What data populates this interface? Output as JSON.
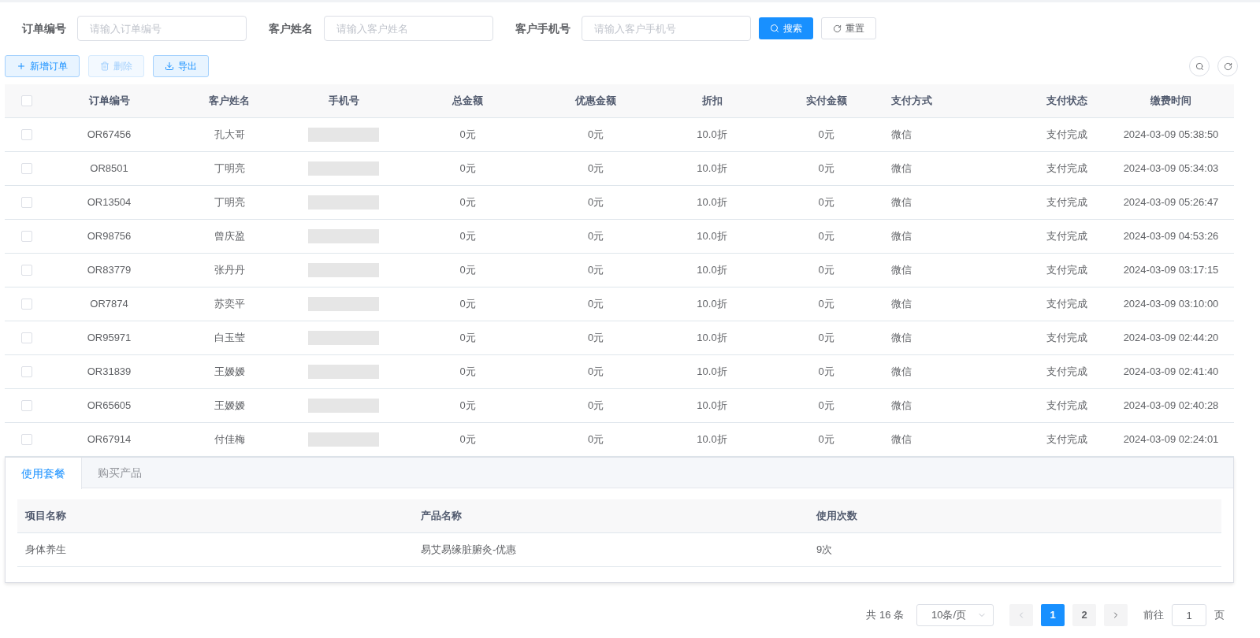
{
  "search_form": {
    "fields": [
      {
        "label": "订单编号",
        "placeholder": "请输入订单编号"
      },
      {
        "label": "客户姓名",
        "placeholder": "请输入客户姓名"
      },
      {
        "label": "客户手机号",
        "placeholder": "请输入客户手机号"
      }
    ],
    "search_button": "搜索",
    "reset_button": "重置"
  },
  "toolbar": {
    "buttons": [
      {
        "kind": "add",
        "label": "新增订单",
        "disabled": false
      },
      {
        "kind": "delete",
        "label": "删除",
        "disabled": true
      },
      {
        "kind": "export",
        "label": "导出",
        "disabled": false
      }
    ]
  },
  "table": {
    "header_checked": false,
    "columns": [
      "订单编号",
      "客户姓名",
      "手机号",
      "总金额",
      "优惠金额",
      "折扣",
      "实付金额",
      "支付方式",
      "支付状态",
      "缴费时间"
    ],
    "rows": [
      {
        "checked": false,
        "cells": [
          "OR67456",
          "孔大哥",
          "",
          "0元",
          "0元",
          "10.0折",
          "0元",
          "微信",
          "支付完成",
          "2024-03-09 05:38:50"
        ]
      },
      {
        "checked": false,
        "cells": [
          "OR8501",
          "丁明亮",
          "",
          "0元",
          "0元",
          "10.0折",
          "0元",
          "微信",
          "支付完成",
          "2024-03-09 05:34:03"
        ]
      },
      {
        "checked": false,
        "cells": [
          "OR13504",
          "丁明亮",
          "",
          "0元",
          "0元",
          "10.0折",
          "0元",
          "微信",
          "支付完成",
          "2024-03-09 05:26:47"
        ]
      },
      {
        "checked": false,
        "cells": [
          "OR98756",
          "曾庆盈",
          "",
          "0元",
          "0元",
          "10.0折",
          "0元",
          "微信",
          "支付完成",
          "2024-03-09 04:53:26"
        ]
      },
      {
        "checked": false,
        "cells": [
          "OR83779",
          "张丹丹",
          "",
          "0元",
          "0元",
          "10.0折",
          "0元",
          "微信",
          "支付完成",
          "2024-03-09 03:17:15"
        ]
      },
      {
        "checked": false,
        "cells": [
          "OR7874",
          "苏奕平",
          "",
          "0元",
          "0元",
          "10.0折",
          "0元",
          "微信",
          "支付完成",
          "2024-03-09 03:10:00"
        ]
      },
      {
        "checked": false,
        "cells": [
          "OR95971",
          "白玉莹",
          "",
          "0元",
          "0元",
          "10.0折",
          "0元",
          "微信",
          "支付完成",
          "2024-03-09 02:44:20"
        ]
      },
      {
        "checked": false,
        "cells": [
          "OR31839",
          "王嫒嫒",
          "",
          "0元",
          "0元",
          "10.0折",
          "0元",
          "微信",
          "支付完成",
          "2024-03-09 02:41:40"
        ]
      },
      {
        "checked": false,
        "cells": [
          "OR65605",
          "王嫒嫒",
          "",
          "0元",
          "0元",
          "10.0折",
          "0元",
          "微信",
          "支付完成",
          "2024-03-09 02:40:28"
        ]
      },
      {
        "checked": false,
        "cells": [
          "OR67914",
          "付佳梅",
          "",
          "0元",
          "0元",
          "10.0折",
          "0元",
          "微信",
          "支付完成",
          "2024-03-09 02:24:01"
        ]
      }
    ]
  },
  "detail": {
    "tabs": [
      {
        "label": "使用套餐",
        "selected": true
      },
      {
        "label": "购买产品",
        "selected": false
      }
    ],
    "columns": [
      "项目名称",
      "产品名称",
      "使用次数"
    ],
    "rows": [
      [
        "身体养生",
        "易艾易缘脏腑灸-优惠",
        "9次"
      ]
    ]
  },
  "pagination": {
    "total": "共 16 条",
    "page_size": "10条/页",
    "pages": [
      {
        "label": "1",
        "selected": true
      },
      {
        "label": "2",
        "selected": false
      }
    ],
    "goto_label": "前往",
    "goto_value": "1",
    "goto_suffix": "页"
  }
}
